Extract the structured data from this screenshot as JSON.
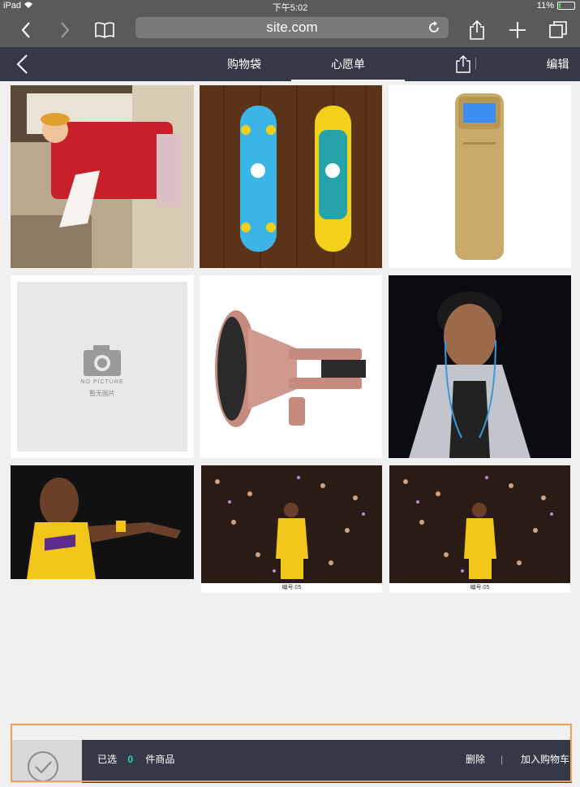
{
  "status_bar": {
    "device": "iPad",
    "time": "下午5:02",
    "battery": "11%",
    "battery_level": 0.11
  },
  "browser": {
    "url": "site.com"
  },
  "app_bar": {
    "tabs": [
      {
        "label": "购物袋",
        "active": false
      },
      {
        "label": "心愿单",
        "active": true
      }
    ],
    "edit_label": "编辑"
  },
  "products": [
    {
      "name": "tissue-box"
    },
    {
      "name": "skateboards"
    },
    {
      "name": "thermos-bottle"
    },
    {
      "name": "no-picture",
      "placeholder_en": "NO PICTURE",
      "placeholder_cn": "暂无图片"
    },
    {
      "name": "car-phone-mount"
    },
    {
      "name": "man-with-earphones"
    },
    {
      "name": "basketball-player"
    },
    {
      "name": "basketball-crowd",
      "caption": "编号:05"
    },
    {
      "name": "basketball-crowd",
      "caption": "编号:05"
    }
  ],
  "bottom_bar": {
    "selected_prefix": "已选",
    "selected_count": "0",
    "selected_suffix": "件商品",
    "delete_label": "删除",
    "divider": "|",
    "add_to_cart_label": "加入购物车"
  },
  "colors": {
    "dark_bar": "#353846",
    "browser_bar": "#5a5a5a",
    "count_accent": "#2fd1c4",
    "highlight_outline": "#f0a050"
  }
}
